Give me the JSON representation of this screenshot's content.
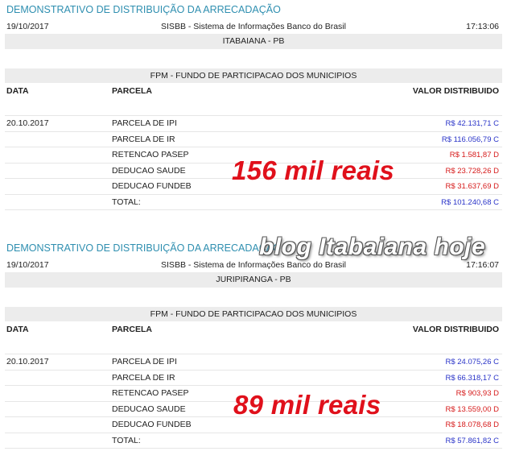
{
  "reports": [
    {
      "title": "DEMONSTRATIVO DE DISTRIBUIÇÃO DA ARRECADAÇÃO",
      "date": "19/10/2017",
      "system": "SISBB - Sistema de Informações Banco do Brasil",
      "time": "17:13:06",
      "municipality": "ITABAIANA - PB",
      "section": "FPM - FUNDO DE PARTICIPACAO DOS MUNICIPIOS",
      "headers": {
        "data": "DATA",
        "parcela": "PARCELA",
        "valor": "VALOR DISTRIBUIDO"
      },
      "rows": [
        {
          "data": "20.10.2017",
          "parcela": "PARCELA DE IPI",
          "valor": "R$ 42.131,71 C",
          "kind": "pos"
        },
        {
          "data": "",
          "parcela": "PARCELA DE IR",
          "valor": "R$ 116.056,79 C",
          "kind": "pos"
        },
        {
          "data": "",
          "parcela": "RETENCAO PASEP",
          "valor": "R$ 1.581,87 D",
          "kind": "neg"
        },
        {
          "data": "",
          "parcela": "DEDUCAO SAUDE",
          "valor": "R$ 23.728,26 D",
          "kind": "neg"
        },
        {
          "data": "",
          "parcela": "DEDUCAO FUNDEB",
          "valor": "R$ 31.637,69 D",
          "kind": "neg"
        },
        {
          "data": "",
          "parcela": "TOTAL:",
          "valor": "R$ 101.240,68 C",
          "kind": "pos"
        }
      ]
    },
    {
      "title": "DEMONSTRATIVO DE DISTRIBUIÇÃO DA ARRECADAÇÃO",
      "date": "19/10/2017",
      "system": "SISBB - Sistema de Informações Banco do Brasil",
      "time": "17:16:07",
      "municipality": "JURIPIRANGA - PB",
      "section": "FPM - FUNDO DE PARTICIPACAO DOS MUNICIPIOS",
      "headers": {
        "data": "DATA",
        "parcela": "PARCELA",
        "valor": "VALOR DISTRIBUIDO"
      },
      "rows": [
        {
          "data": "20.10.2017",
          "parcela": "PARCELA DE IPI",
          "valor": "R$ 24.075,26 C",
          "kind": "pos"
        },
        {
          "data": "",
          "parcela": "PARCELA DE IR",
          "valor": "R$ 66.318,17 C",
          "kind": "pos"
        },
        {
          "data": "",
          "parcela": "RETENCAO PASEP",
          "valor": "R$ 903,93 D",
          "kind": "neg"
        },
        {
          "data": "",
          "parcela": "DEDUCAO SAUDE",
          "valor": "R$ 13.559,00 D",
          "kind": "neg"
        },
        {
          "data": "",
          "parcela": "DEDUCAO FUNDEB",
          "valor": "R$ 18.078,68 D",
          "kind": "neg"
        },
        {
          "data": "",
          "parcela": "TOTAL:",
          "valor": "R$ 57.861,82 C",
          "kind": "pos"
        }
      ]
    }
  ],
  "overlays": {
    "first": "156 mil reais",
    "second": "89 mil reais",
    "watermark": "blog Itabaiana hoje"
  },
  "colors": {
    "credit": "#2a34c8",
    "debit": "#d61a1a",
    "title": "#2f8fb0",
    "overlay": "#e0101b"
  }
}
